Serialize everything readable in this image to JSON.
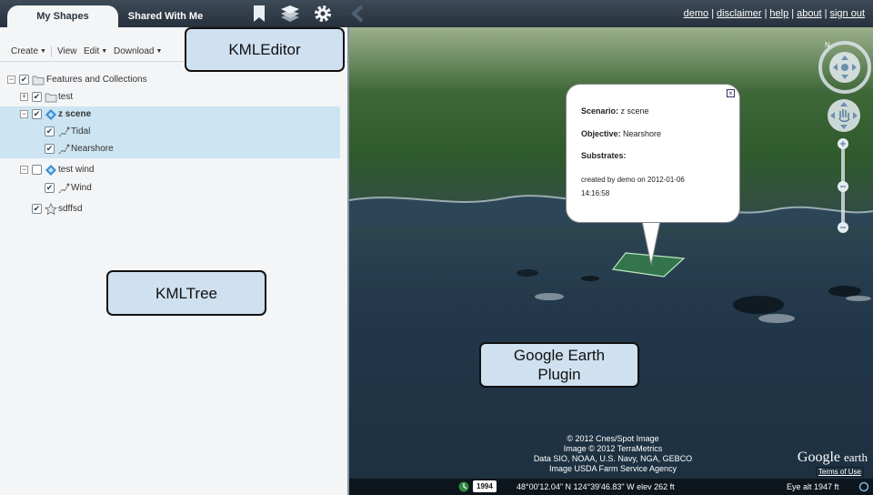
{
  "header": {
    "tabs": [
      {
        "label": "My Shapes",
        "active": true
      },
      {
        "label": "Shared With Me",
        "active": false
      }
    ],
    "icons": [
      "bookmark-icon",
      "layers-icon",
      "gear-icon",
      "collapse-chevron-icon"
    ],
    "links": [
      "demo",
      "disclaimer",
      "help",
      "about",
      "sign out"
    ],
    "separator": "|"
  },
  "toolbar": {
    "create": "Create",
    "view": "View",
    "edit": "Edit",
    "download": "Download"
  },
  "tree": {
    "items": [
      {
        "label": "Features and Collections",
        "checked": true,
        "icon": "folder-icon"
      },
      {
        "label": "test",
        "checked": true,
        "icon": "folder-icon"
      },
      {
        "label": "z scene",
        "checked": true,
        "icon": "scenario-icon",
        "selected": true
      },
      {
        "label": "Tidal",
        "checked": true,
        "icon": "objective-icon",
        "selected": true
      },
      {
        "label": "Nearshore",
        "checked": true,
        "icon": "objective-icon",
        "selected": true
      },
      {
        "label": "test wind",
        "checked": false,
        "icon": "scenario-icon"
      },
      {
        "label": "Wind",
        "checked": true,
        "icon": "objective-icon"
      },
      {
        "label": "sdffsd",
        "checked": true,
        "icon": "star-shape-icon"
      }
    ]
  },
  "annotations": {
    "kmleditor": "KMLEditor",
    "kmltree": "KMLTree",
    "gep_line1": "Google Earth",
    "gep_line2": "Plugin"
  },
  "popup": {
    "scenario_label": "Scenario:",
    "scenario_value": "z scene",
    "objective_label": "Objective:",
    "objective_value": "Nearshore",
    "substrates_label": "Substrates:",
    "created_line1": "created by demo on 2012-01-06",
    "created_line2": "14:16:58"
  },
  "map": {
    "credits": [
      "© 2012 Cnes/Spot Image",
      "Image © 2012 TerraMetrics",
      "Data SIO, NOAA, U.S. Navy, NGA, GEBCO",
      "Image USDA Farm Service Agency"
    ],
    "logo_main": "Google",
    "logo_sub": "earth",
    "terms": "Terms of Use",
    "year": "1994",
    "coords": "48°00'12.04\" N  124°39'46.83\" W elev   262 ft",
    "eye_alt": "Eye alt     1947 ft"
  },
  "colors": {
    "topbar": "#2b3641",
    "selection": "#cde4f2",
    "callout": "#cfe0f0",
    "polygon": "#3ea04a"
  }
}
